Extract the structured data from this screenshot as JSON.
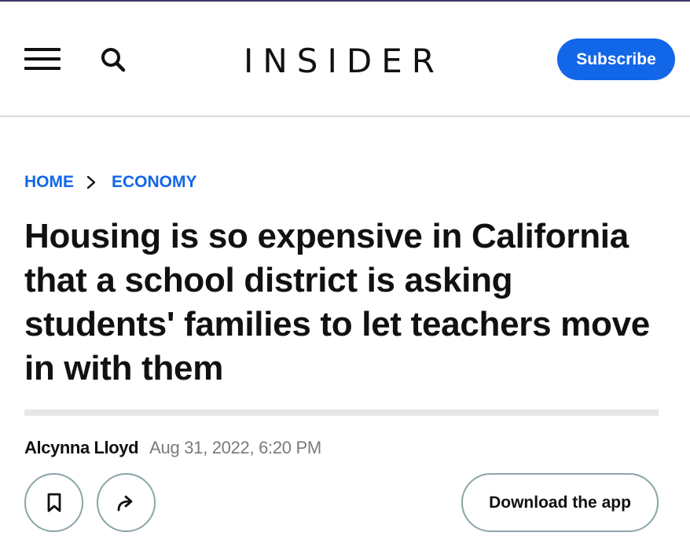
{
  "header": {
    "logo_text": "INSIDER",
    "subscribe_label": "Subscribe",
    "menu_icon": "hamburger-menu-icon",
    "search_icon": "search-icon"
  },
  "breadcrumb": {
    "items": [
      "HOME",
      "ECONOMY"
    ],
    "separator_icon": "chevron-right-icon"
  },
  "article": {
    "headline": "Housing is so expensive in California that a school district is asking students' families to let teachers move in with them",
    "author": "Alcynna Lloyd",
    "date": "Aug 31, 2022, 6:20 PM"
  },
  "actions": {
    "bookmark_icon": "bookmark-icon",
    "share_icon": "share-icon",
    "download_label": "Download the app"
  },
  "colors": {
    "accent": "#1266e8",
    "text": "#111111",
    "muted": "#7a7a7a",
    "button_border": "#8aa5a9",
    "divider": "#e6e6e6"
  }
}
